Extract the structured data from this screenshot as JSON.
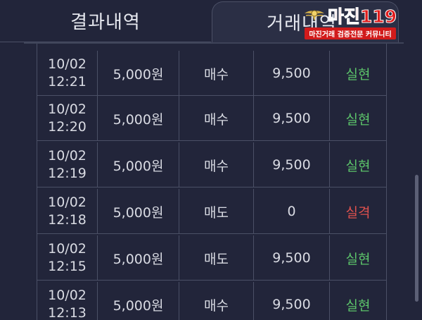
{
  "tabs": {
    "results_label": "결과내역",
    "history_label": "거래내역"
  },
  "watermark": {
    "brand": "마진119",
    "tagline": "마진거래 검증전문 커뮤니티"
  },
  "rows": [
    {
      "date": "10/02",
      "time": "12:21",
      "amount": "5,000원",
      "type": "매수",
      "price": "9,500",
      "result": "실현",
      "status": "win"
    },
    {
      "date": "10/02",
      "time": "12:20",
      "amount": "5,000원",
      "type": "매수",
      "price": "9,500",
      "result": "실현",
      "status": "win"
    },
    {
      "date": "10/02",
      "time": "12:19",
      "amount": "5,000원",
      "type": "매수",
      "price": "9,500",
      "result": "실현",
      "status": "win"
    },
    {
      "date": "10/02",
      "time": "12:18",
      "amount": "5,000원",
      "type": "매도",
      "price": "0",
      "result": "실격",
      "status": "loss"
    },
    {
      "date": "10/02",
      "time": "12:15",
      "amount": "5,000원",
      "type": "매도",
      "price": "9,500",
      "result": "실현",
      "status": "win"
    },
    {
      "date": "10/02",
      "time": "12:13",
      "amount": "5,000원",
      "type": "매수",
      "price": "9,500",
      "result": "실현",
      "status": "win"
    }
  ],
  "colors": {
    "background": "#22253a",
    "win": "#5cc46a",
    "loss": "#e0514e",
    "brand_red": "#e01c1c"
  }
}
